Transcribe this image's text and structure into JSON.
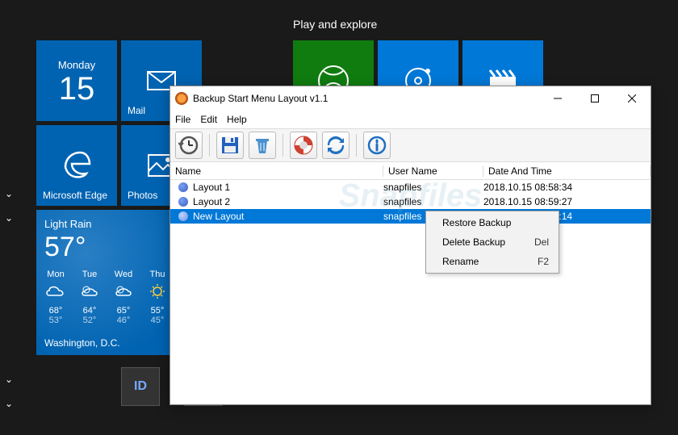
{
  "start": {
    "section_label": "Play and explore",
    "calendar": {
      "day": "Monday",
      "date": "15"
    },
    "mail_label": "Mail",
    "edge_label": "Microsoft Edge",
    "photos_label": "Photos",
    "weather": {
      "condition": "Light Rain",
      "temp": "57°",
      "city": "Washington, D.C.",
      "forecast": [
        {
          "day": "Mon",
          "hi": "68°",
          "lo": "53°"
        },
        {
          "day": "Tue",
          "hi": "64°",
          "lo": "52°"
        },
        {
          "day": "Wed",
          "hi": "65°",
          "lo": "46°"
        },
        {
          "day": "Thu",
          "hi": "55°",
          "lo": "45°"
        }
      ]
    }
  },
  "window": {
    "title": "Backup Start Menu Layout v1.1",
    "menus": {
      "file": "File",
      "edit": "Edit",
      "help": "Help"
    },
    "columns": {
      "name": "Name",
      "user": "User Name",
      "date": "Date And Time"
    },
    "rows": [
      {
        "name": "Layout 1",
        "user": "snapfiles",
        "date": "2018.10.15 08:58:34"
      },
      {
        "name": "Layout 2",
        "user": "snapfiles",
        "date": "2018.10.15 08:59:27"
      },
      {
        "name": "New Layout",
        "user": "snapfiles",
        "date": "2018.10.15 09:04:14"
      }
    ],
    "context": {
      "restore": "Restore Backup",
      "delete": "Delete Backup",
      "delete_key": "Del",
      "rename": "Rename",
      "rename_key": "F2"
    },
    "watermark": "Snapfiles"
  }
}
